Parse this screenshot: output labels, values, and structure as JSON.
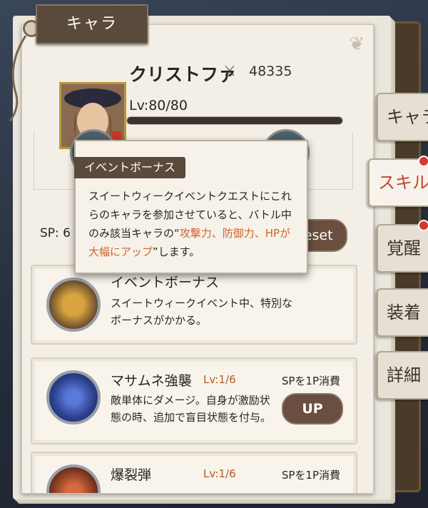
{
  "header": {
    "tab_label": "キャラ"
  },
  "character": {
    "name": "クリストファ",
    "power": "48335",
    "level": "Lv:80/80",
    "level_progress": 1.0
  },
  "sp": {
    "label": "SP: 6",
    "reset_label": "Reset"
  },
  "tooltip": {
    "title": "イベントボーナス",
    "text_before": "スイートウィークイベントクエストにこれらのキャラを参加させていると、バトル中のみ該当キャラの“",
    "text_highlight": "攻撃力、防御力、HPが大幅にアップ",
    "text_after": "”します。"
  },
  "skills": [
    {
      "title": "イベントボーナス",
      "desc": "スイートウィークイベント中、特別なボーナスがかかる。"
    },
    {
      "title": "マサムネ強襲",
      "lv": "Lv:1/6",
      "cost": "SPを1P消費",
      "desc": "敵単体にダメージ。自身が激励状態の時、追加で盲目状態を付与。",
      "up_label": "UP"
    },
    {
      "title": "爆裂弾",
      "lv": "Lv:1/6",
      "cost": "SPを1P消費"
    }
  ],
  "side_tabs": [
    {
      "label": "キャラ"
    },
    {
      "label": "スキル"
    },
    {
      "label": "覚醒"
    },
    {
      "label": "装着"
    },
    {
      "label": "詳細"
    }
  ],
  "colors": {
    "accent": "#d0632a",
    "active_tab": "#c4462c",
    "button": "#6a4e3f"
  }
}
